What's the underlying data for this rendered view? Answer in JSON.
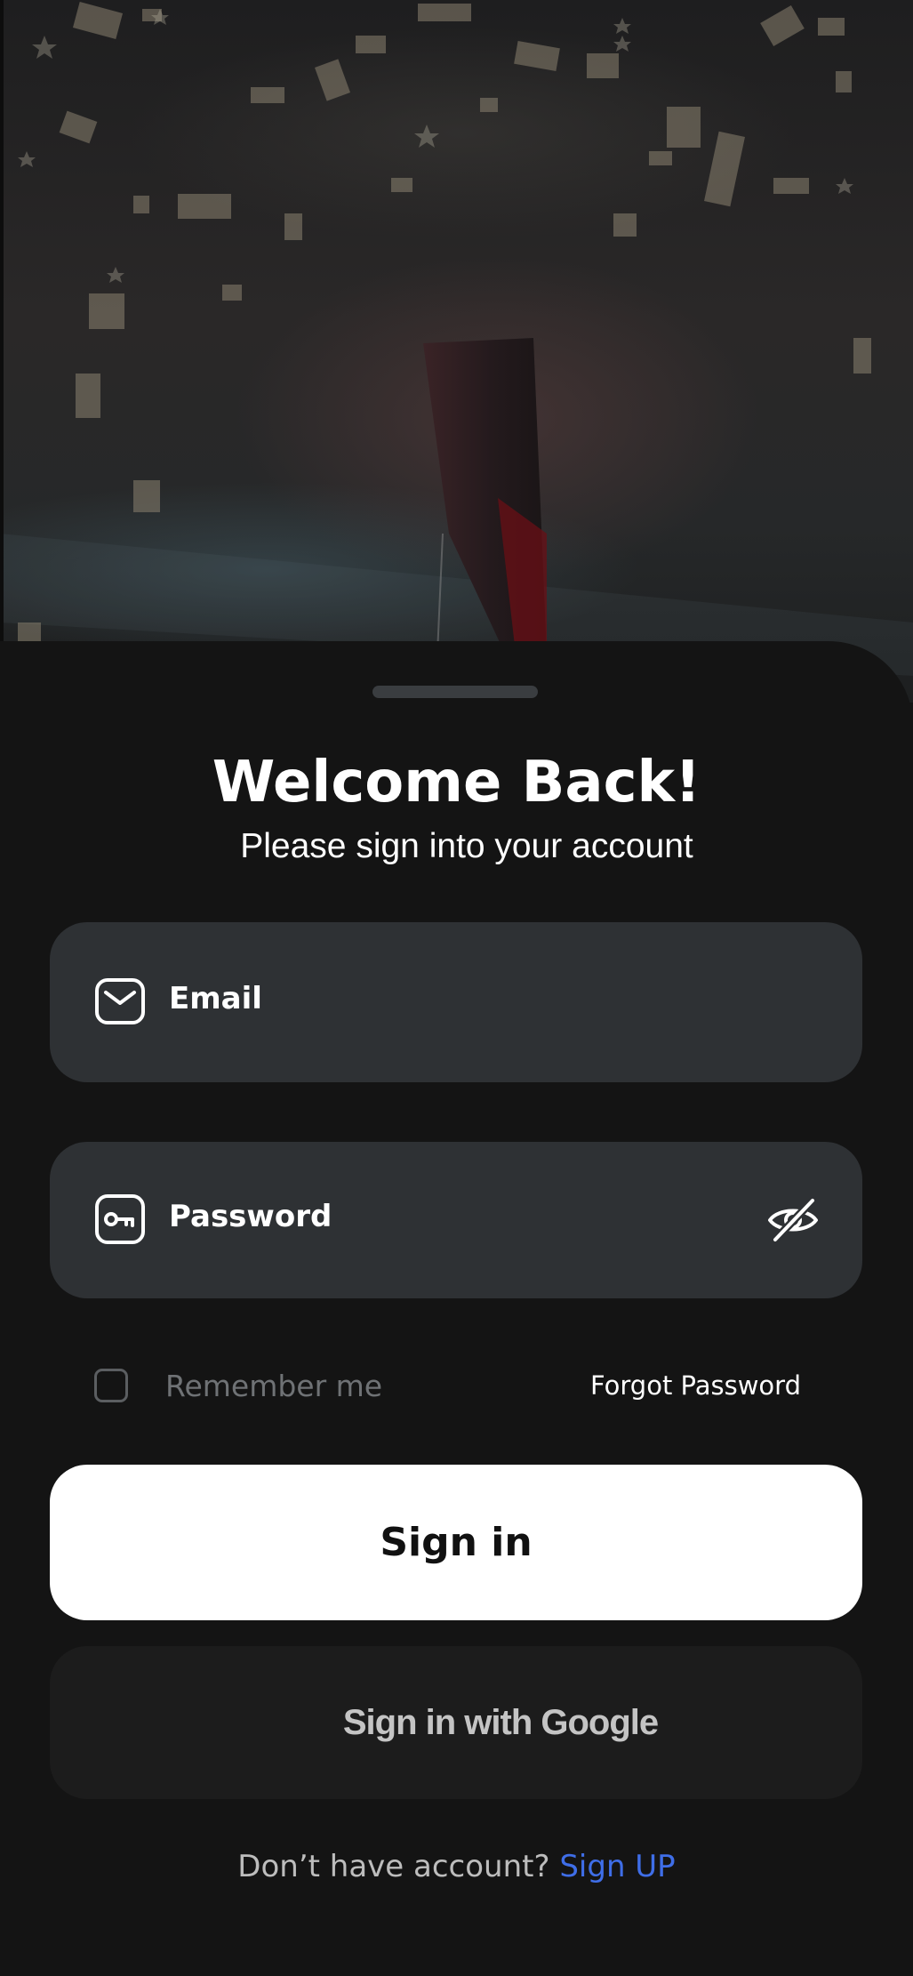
{
  "header": {
    "title": "Welcome Back!",
    "subtitle": "Please sign into your account"
  },
  "form": {
    "email": {
      "placeholder": "Email",
      "icon": "mail-icon"
    },
    "password": {
      "placeholder": "Password",
      "icon": "key-icon",
      "toggle_icon": "eye-off-icon"
    },
    "remember_label": "Remember me",
    "forgot_label": "Forgot Password",
    "remember_checked": false
  },
  "actions": {
    "signin_label": "Sign in",
    "google_label": "Sign in with Google"
  },
  "footer": {
    "prompt": "Don’t have account?",
    "signup_label": "Sign UP"
  },
  "colors": {
    "background": "#141414",
    "field": "#2e3134",
    "primary_button": "#ffffff",
    "secondary_button": "#1c1c1c",
    "link": "#3f6ee8",
    "muted_text": "#6f7275"
  }
}
